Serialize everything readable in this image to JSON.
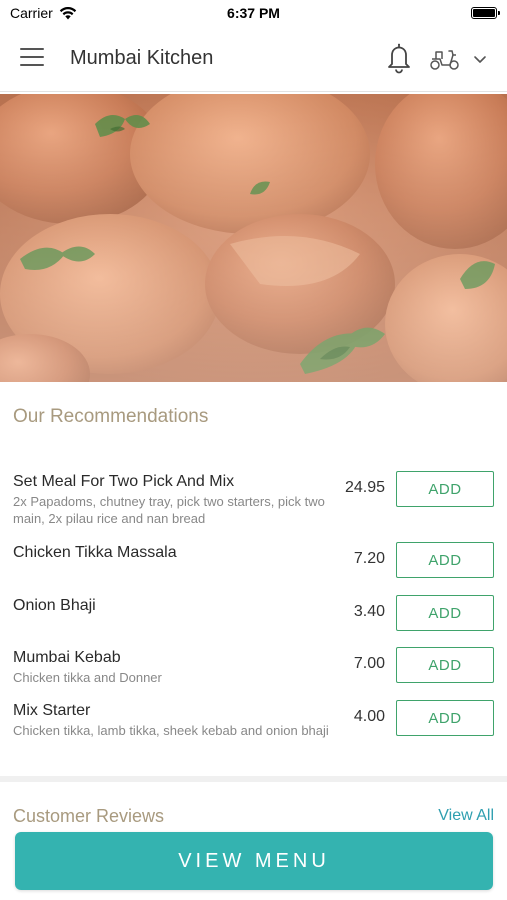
{
  "status_bar": {
    "carrier": "Carrier",
    "time": "6:37 PM",
    "battery_level": 1.0
  },
  "header": {
    "title": "Mumbai Kitchen",
    "menu_icon": "hamburger-menu-icon",
    "notification_icon": "bell-icon",
    "delivery_icon": "scooter-icon",
    "dropdown_icon": "chevron-down-icon"
  },
  "recommendations": {
    "title": "Our Recommendations",
    "items": [
      {
        "name": "Set Meal For Two Pick And Mix",
        "description": "2x Papadoms, chutney tray, pick two starters, pick two main, 2x pilau rice and nan bread",
        "price": "24.95",
        "add_label": "ADD"
      },
      {
        "name": "Chicken Tikka Massala",
        "description": "",
        "price": "7.20",
        "add_label": "ADD"
      },
      {
        "name": "Onion Bhaji",
        "description": "",
        "price": "3.40",
        "add_label": "ADD"
      },
      {
        "name": "Mumbai Kebab",
        "description": "Chicken tikka and Donner",
        "price": "7.00",
        "add_label": "ADD"
      },
      {
        "name": "Mix Starter",
        "description": "Chicken tikka, lamb tikka, sheek kebab and onion bhaji",
        "price": "4.00",
        "add_label": "ADD"
      }
    ]
  },
  "reviews": {
    "title": "Customer Reviews",
    "view_all_label": "View All"
  },
  "footer": {
    "view_menu_label": "VIEW MENU"
  },
  "colors": {
    "accent_teal": "#34b3b0",
    "add_green": "#3fa36b",
    "section_title": "#a89a7f",
    "link_blue": "#2f9fb0"
  }
}
